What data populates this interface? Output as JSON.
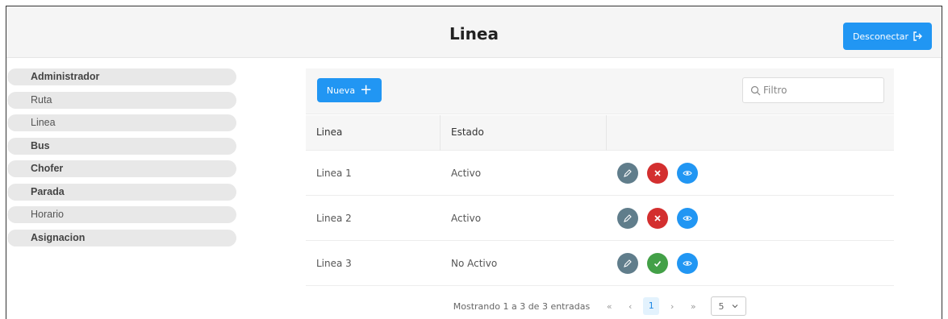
{
  "header": {
    "title": "Linea",
    "logout_label": "Desconectar"
  },
  "sidebar": {
    "items": [
      {
        "label": "Administrador"
      },
      {
        "label": "Ruta"
      },
      {
        "label": "Linea"
      },
      {
        "label": "Bus"
      },
      {
        "label": "Chofer"
      },
      {
        "label": "Parada"
      },
      {
        "label": "Horario"
      },
      {
        "label": "Asignacion"
      }
    ]
  },
  "toolbar": {
    "new_label": "Nueva",
    "filter_placeholder": "Filtro"
  },
  "table": {
    "columns": [
      "Linea",
      "Estado"
    ],
    "rows": [
      {
        "linea": "Linea 1",
        "estado": "Activo",
        "toggle": "deactivate"
      },
      {
        "linea": "Linea 2",
        "estado": "Activo",
        "toggle": "deactivate"
      },
      {
        "linea": "Linea 3",
        "estado": "No Activo",
        "toggle": "activate"
      }
    ]
  },
  "pagination": {
    "info": "Mostrando 1 a 3 de 3 entradas",
    "first": "«",
    "prev": "‹",
    "current_page": "1",
    "next": "›",
    "last": "»",
    "rows_per_page": "5"
  },
  "colors": {
    "primary": "#2196f3",
    "edit": "#607d8b",
    "delete": "#d32f2f",
    "activate": "#43a047",
    "view": "#2196f3"
  }
}
